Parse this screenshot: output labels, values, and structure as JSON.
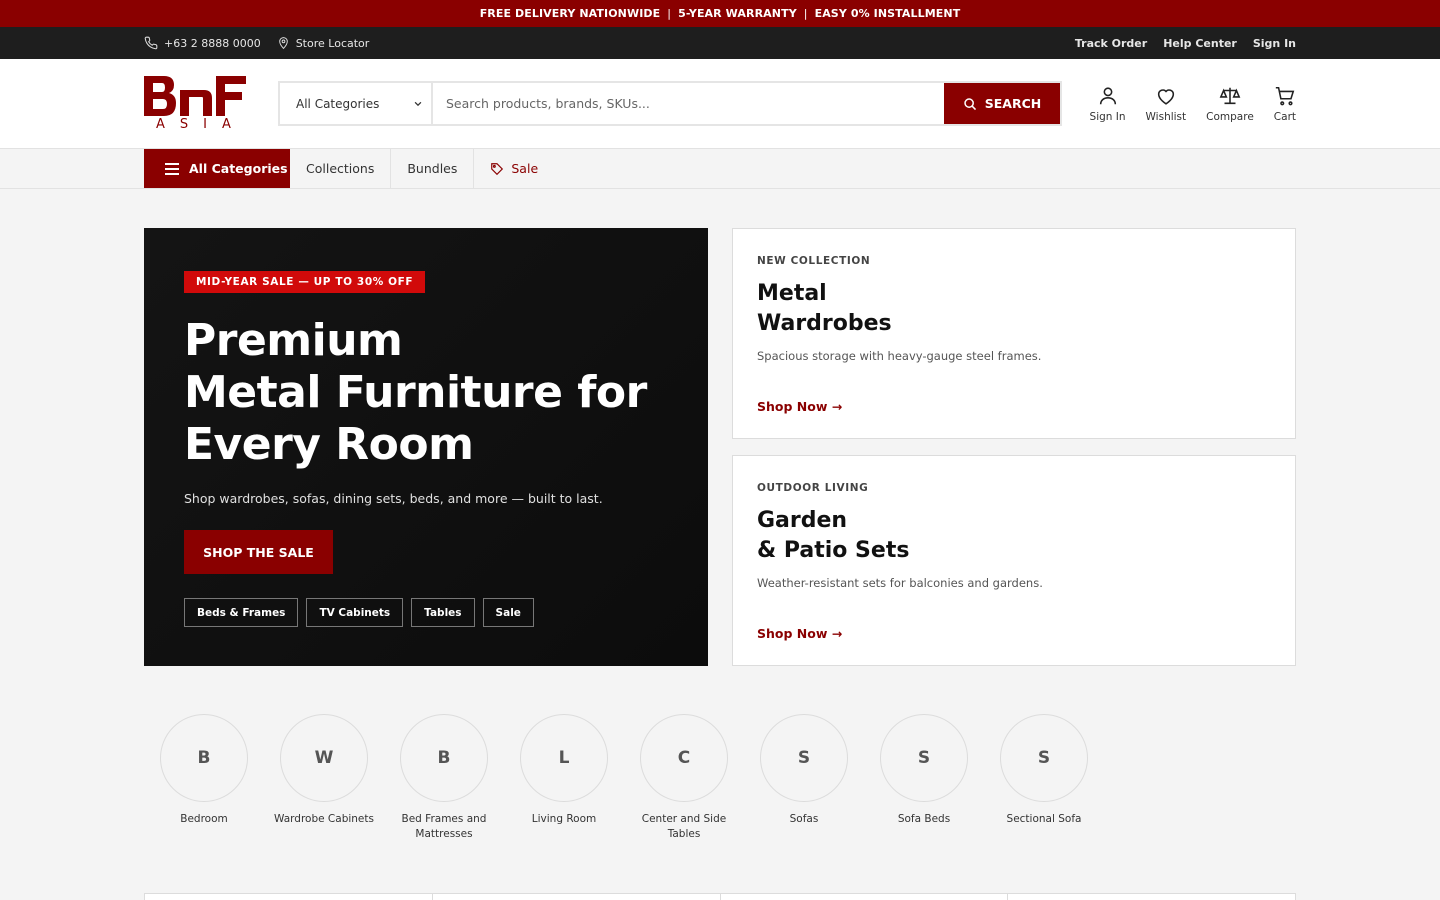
{
  "promo_bar": {
    "items": [
      "FREE DELIVERY NATIONWIDE",
      "5-YEAR WARRANTY",
      "EASY 0% INSTALLMENT"
    ],
    "separator": "|"
  },
  "utility_bar": {
    "phone": "+63 2 8888 0000",
    "store_locator": "Store Locator",
    "links": [
      "Track Order",
      "Help Center",
      "Sign In"
    ]
  },
  "logo": {
    "subtext": "ASIA"
  },
  "search": {
    "category_selected": "All Categories",
    "placeholder": "Search products, brands, SKUs...",
    "button_label": "SEARCH"
  },
  "header_actions": {
    "sign_in": "Sign In",
    "wishlist": "Wishlist",
    "compare": "Compare",
    "cart": "Cart"
  },
  "nav": {
    "all_categories": "All Categories",
    "links": [
      "Collections",
      "Bundles"
    ],
    "sale": "Sale"
  },
  "hero": {
    "badge": "MID-YEAR SALE — UP TO 30% OFF",
    "title_lines": [
      "Premium",
      "Metal Furniture for",
      "Every Room"
    ],
    "subtitle": "Shop wardrobes, sofas, dining sets, beds, and more — built to last.",
    "cta": "SHOP THE SALE",
    "chips": [
      "Beds & Frames",
      "TV Cabinets",
      "Tables",
      "Sale"
    ]
  },
  "promo_cards": [
    {
      "eyebrow": "NEW COLLECTION",
      "title_lines": [
        "Metal",
        "Wardrobes"
      ],
      "description": "Spacious storage with heavy-gauge steel frames.",
      "link": "Shop Now →"
    },
    {
      "eyebrow": "OUTDOOR LIVING",
      "title_lines": [
        "Garden",
        "& Patio Sets"
      ],
      "description": "Weather-resistant sets for balconies and gardens.",
      "link": "Shop Now →"
    }
  ],
  "categories": [
    {
      "initial": "B",
      "label": "Bedroom"
    },
    {
      "initial": "W",
      "label": "Wardrobe Cabinets"
    },
    {
      "initial": "B",
      "label": "Bed Frames and Mattresses"
    },
    {
      "initial": "L",
      "label": "Living Room"
    },
    {
      "initial": "C",
      "label": "Center and Side Tables"
    },
    {
      "initial": "S",
      "label": "Sofas"
    },
    {
      "initial": "S",
      "label": "Sofa Beds"
    },
    {
      "initial": "S",
      "label": "Sectional Sofa"
    }
  ],
  "colors": {
    "brand": "#8a0000",
    "badge_red": "#d10a0a",
    "utility_bg": "#1e1e1e",
    "hero_bg": "#111111"
  }
}
